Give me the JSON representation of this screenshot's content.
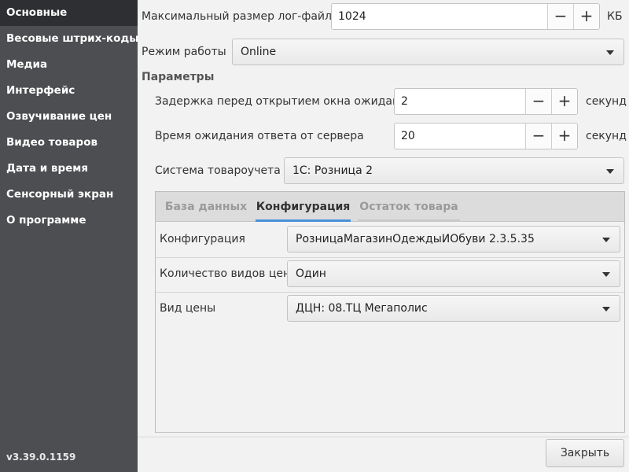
{
  "sidebar": {
    "items": [
      {
        "label": "Основные",
        "active": true
      },
      {
        "label": "Весовые штрих-коды"
      },
      {
        "label": "Медиа"
      },
      {
        "label": "Интерфейс"
      },
      {
        "label": "Озвучивание цен"
      },
      {
        "label": "Видео товаров"
      },
      {
        "label": "Дата и время"
      },
      {
        "label": "Сенсорный экран"
      },
      {
        "label": "О программе"
      }
    ],
    "version": "v3.39.0.1159"
  },
  "settings": {
    "log_size": {
      "label": "Максимальный размер лог-файла",
      "value": "1024",
      "unit": "КБ"
    },
    "mode": {
      "label": "Режим работы",
      "value": "Online"
    },
    "params_title": "Параметры",
    "wait_delay": {
      "label": "Задержка перед открытием окна ожидания",
      "value": "2",
      "unit": "секунд"
    },
    "server_timeout": {
      "label": "Время ожидания ответа от сервера",
      "value": "20",
      "unit": "секунд"
    },
    "accounting_system": {
      "label": "Система товароучета",
      "value": "1С: Розница 2"
    }
  },
  "buttons": {
    "minus": "−",
    "plus": "+",
    "close": "Закрыть"
  },
  "tabs": [
    {
      "label": "База данных",
      "active": false
    },
    {
      "label": "Конфигурация",
      "active": true
    },
    {
      "label": "Остаток товара",
      "active": false
    }
  ],
  "config_tab": {
    "configuration": {
      "label": "Конфигурация",
      "value": "РозницаМагазинОдеждыИОбуви 2.3.5.35"
    },
    "price_types_count": {
      "label": "Количество видов цен",
      "value": "Один"
    },
    "price_type": {
      "label": "Вид цены",
      "value": "ДЦН: 08.ТЦ Мегаполис"
    }
  },
  "colors": {
    "sidebar_bg": "#4d4e51",
    "sidebar_active": "#2e2f32",
    "accent": "#4a90d9"
  }
}
